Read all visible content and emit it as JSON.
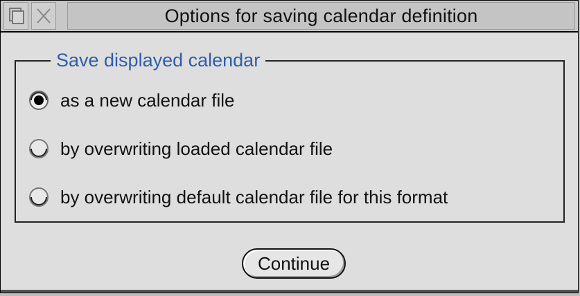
{
  "window": {
    "title": "Options for saving calendar definition"
  },
  "titlebar": {
    "back_icon": "back-icon",
    "close_icon": "close-icon"
  },
  "group": {
    "legend": "Save displayed calendar",
    "options": [
      {
        "label": "as a new calendar file",
        "selected": true
      },
      {
        "label": "by overwriting loaded calendar file",
        "selected": false
      },
      {
        "label": "by overwriting default calendar file for this format",
        "selected": false
      }
    ]
  },
  "actions": {
    "continue_label": "Continue"
  },
  "colors": {
    "legend_text": "#2f5eaa",
    "window_bg": "#dedede"
  }
}
